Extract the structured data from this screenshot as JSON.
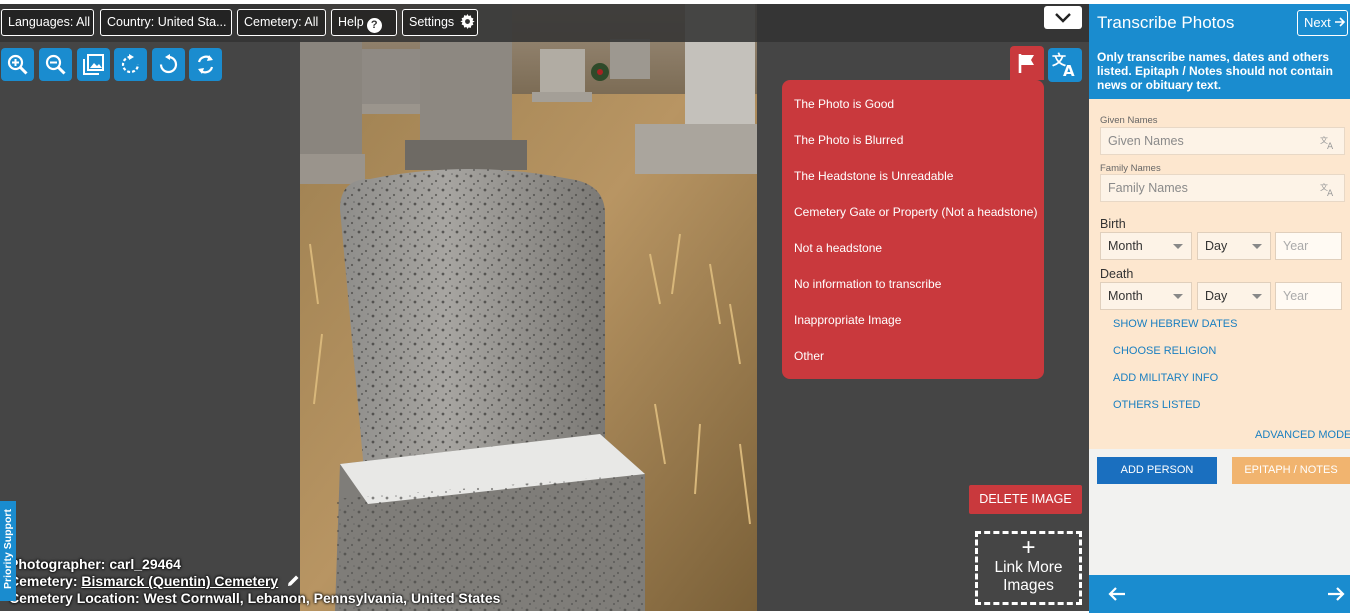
{
  "toolbar": {
    "languages": "Languages: All",
    "country": "Country: United Sta...",
    "cemetery": "Cemetery: All",
    "help": "Help",
    "settings": "Settings"
  },
  "flag_menu": {
    "items": [
      "The Photo is Good",
      "The Photo is Blurred",
      "The Headstone is Unreadable",
      "Cemetery Gate or Property (Not a headstone)",
      "Not a headstone",
      "No information to transcribe",
      "Inappropriate Image",
      "Other"
    ]
  },
  "viewer": {
    "delete_label": "DELETE IMAGE",
    "link_more_line1": "Link More",
    "link_more_line2": "Images",
    "priority_support": "Priority Support"
  },
  "photo_info": {
    "photographer_label": "Photographer:",
    "photographer": "carl_29464",
    "cemetery_label": "Cemetery:",
    "cemetery": "Bismarck (Quentin) Cemetery",
    "location_label": "Cemetery Location:",
    "location": "West Cornwall, Lebanon, Pennsylvania, United States"
  },
  "panel": {
    "title": "Transcribe Photos",
    "next_label": "Next",
    "note": "Only transcribe names, dates and others listed. Epitaph / Notes should not contain news or obituary text.",
    "given_names_label": "Given Names",
    "given_names_placeholder": "Given Names",
    "family_names_label": "Family Names",
    "family_names_placeholder": "Family Names",
    "birth_label": "Birth",
    "death_label": "Death",
    "month": "Month",
    "day": "Day",
    "year": "Year",
    "show_hebrew": "SHOW HEBREW DATES",
    "choose_religion": "CHOOSE RELIGION",
    "add_military": "ADD MILITARY INFO",
    "others_listed": "OTHERS LISTED",
    "advanced_mode": "ADVANCED MODE",
    "add_person": "ADD PERSON",
    "epitaph_notes": "EPITAPH / NOTES"
  },
  "colors": {
    "accent_blue": "#1a8ccf",
    "flag_red": "#c9393d",
    "form_bg": "#fde7cf",
    "epitaph_orange": "#f1b46f"
  }
}
